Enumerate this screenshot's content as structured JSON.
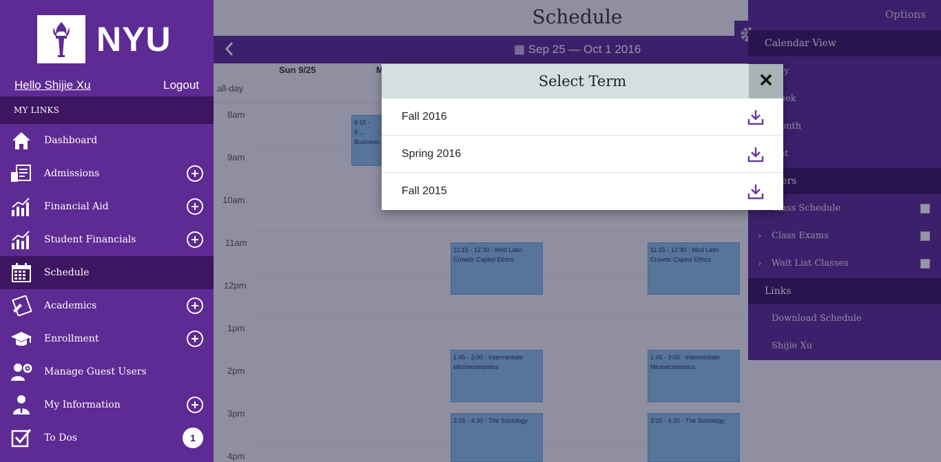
{
  "brand": {
    "logo_text": "NYU"
  },
  "user": {
    "greeting": "Hello Shijie Xu",
    "logout_label": "Logout"
  },
  "sidebar": {
    "section_label": "MY LINKS",
    "items": [
      {
        "label": "Dashboard",
        "icon": "home-icon",
        "expandable": false
      },
      {
        "label": "Admissions",
        "icon": "admissions-icon",
        "expandable": true
      },
      {
        "label": "Financial Aid",
        "icon": "chart-icon",
        "expandable": true
      },
      {
        "label": "Student Financials",
        "icon": "chart-icon",
        "expandable": true
      },
      {
        "label": "Schedule",
        "icon": "calendar-icon",
        "expandable": false,
        "active": true
      },
      {
        "label": "Academics",
        "icon": "academics-icon",
        "expandable": true
      },
      {
        "label": "Enrollment",
        "icon": "graduation-cap-icon",
        "expandable": true
      },
      {
        "label": "Manage Guest Users",
        "icon": "users-gear-icon",
        "expandable": false
      },
      {
        "label": "My Information",
        "icon": "person-icon",
        "expandable": true
      },
      {
        "label": "To Dos",
        "icon": "checkbox-icon",
        "badge": "1"
      }
    ]
  },
  "main": {
    "title": "Schedule",
    "date_range": "Sep 25 — Oct 1 2016",
    "day_headers": [
      "Sun 9/25",
      "M"
    ],
    "allday_label": "all-day",
    "time_labels": [
      "8am",
      "9am",
      "10am",
      "11am",
      "12pm",
      "1pm",
      "2pm",
      "3pm",
      "4pm"
    ],
    "events": [
      {
        "text": "8:15 - 9:... Business..."
      },
      {
        "text": "11:15 - 12:30 · Mod Latin Crowds Capitol Ethics"
      },
      {
        "text": "11:15 - 12:30 · Mod Latin Crowds Capitol Ethics"
      },
      {
        "text": "1:45 - 3:00 · Intermediate Microeconomics"
      },
      {
        "text": "1:45 - 3:00 · Intermediate Microeconomics"
      },
      {
        "text": "3:15 - 4:30 · The Sociology"
      },
      {
        "text": "3:15 - 4:30 · The Sociology"
      }
    ]
  },
  "options": {
    "title": "Options",
    "calendar_view_label": "Calendar View",
    "views": [
      "Day",
      "Week",
      "Month",
      "List"
    ],
    "filters_label": "Filters",
    "filters": [
      "Class Schedule",
      "Class Exams",
      "Wait List Classes"
    ],
    "links_label": "Links",
    "links": [
      "Download Schedule",
      "Shijie Xu"
    ]
  },
  "modal": {
    "title": "Select Term",
    "terms": [
      "Fall 2016",
      "Spring 2016",
      "Fall 2015"
    ]
  },
  "colors": {
    "brand_purple": "#5e2a93",
    "dark_purple": "#3d1560",
    "modal_header": "#d3dfe0"
  }
}
